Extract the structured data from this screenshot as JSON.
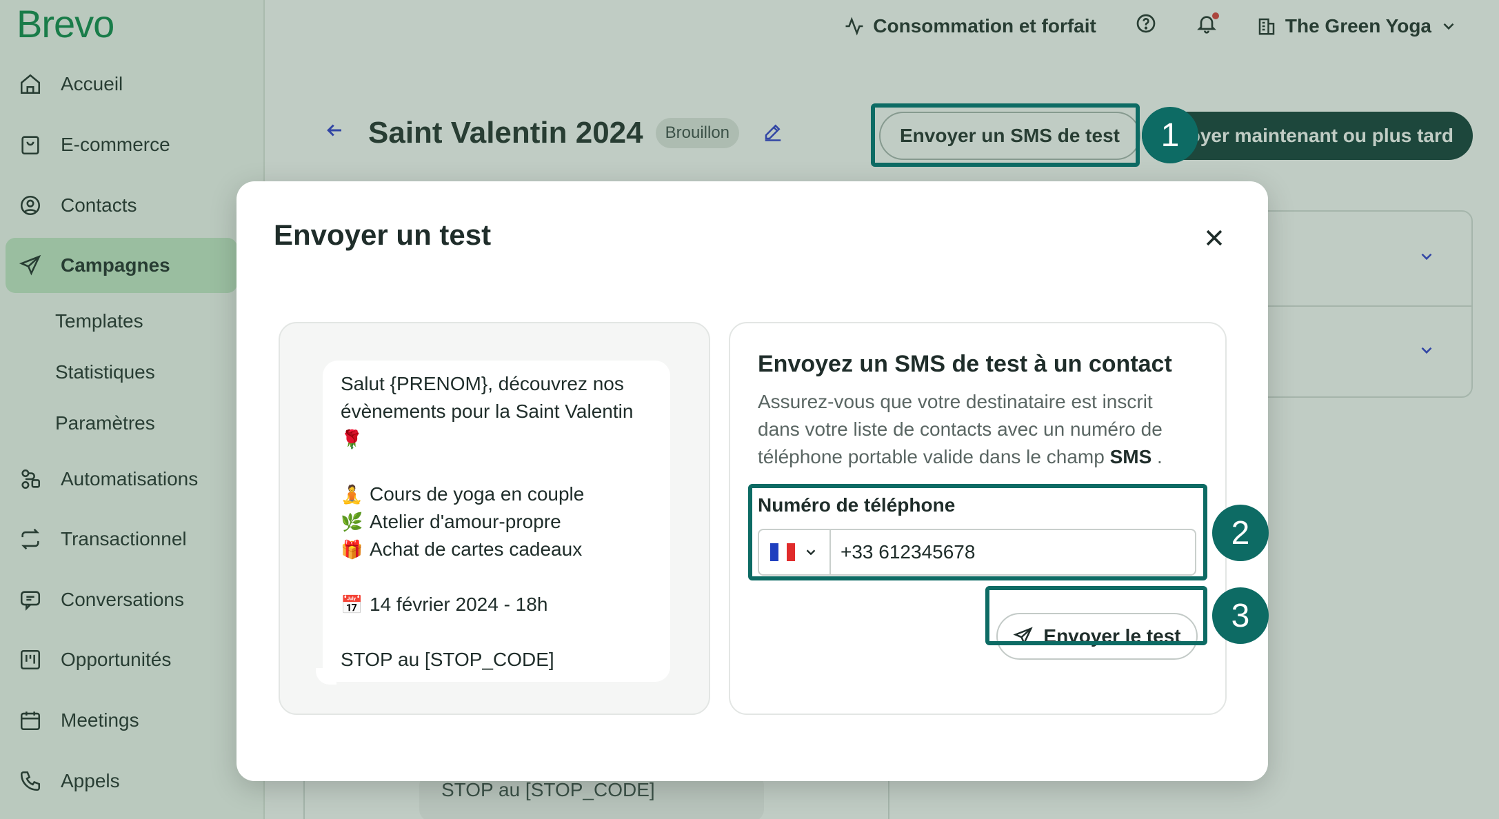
{
  "brand": {
    "logo": "Brevo"
  },
  "sidebar": {
    "items": [
      {
        "label": "Accueil",
        "icon": "home-icon"
      },
      {
        "label": "E-commerce",
        "icon": "shopping-bag-icon"
      },
      {
        "label": "Contacts",
        "icon": "user-circle-icon"
      },
      {
        "label": "Campagnes",
        "icon": "paper-plane-icon",
        "active": true
      },
      {
        "label": "Automatisations",
        "icon": "workflow-icon"
      },
      {
        "label": "Transactionnel",
        "icon": "repeat-icon"
      },
      {
        "label": "Conversations",
        "icon": "chat-icon"
      },
      {
        "label": "Opportunités",
        "icon": "kanban-icon"
      },
      {
        "label": "Meetings",
        "icon": "calendar-icon"
      },
      {
        "label": "Appels",
        "icon": "phone-icon"
      }
    ],
    "subitems": [
      "Templates",
      "Statistiques",
      "Paramètres"
    ]
  },
  "header": {
    "usage_link": "Consommation et forfait",
    "account_name": "The Green Yoga"
  },
  "campaign": {
    "title": "Saint Valentin 2024",
    "status": "Brouillon",
    "send_test_label": "Envoyer un SMS de test",
    "send_label": "Envoyer maintenant ou plus tard"
  },
  "background": {
    "stop_text": "STOP au [STOP_CODE]"
  },
  "modal": {
    "title": "Envoyer un test",
    "preview": {
      "line1": "Salut {PRENOM}, découvrez nos",
      "line2": "évènements pour la Saint Valentin",
      "emoji_rose": "🌹",
      "item1_emoji": "🧘",
      "item1": "Cours de yoga en couple",
      "item2_emoji": "🌿",
      "item2": "Atelier d'amour-propre",
      "item3_emoji": "🎁",
      "item3": "Achat de cartes cadeaux",
      "date_emoji": "📅",
      "date": "14 février 2024 - 18h",
      "stop": "STOP au [STOP_CODE]"
    },
    "form": {
      "title": "Envoyez un SMS de test à un contact",
      "desc_part1": "Assurez-vous que votre destinataire est inscrit dans votre liste de contacts avec un numéro de téléphone portable valide dans le champ",
      "desc_bold": "SMS",
      "desc_end": ".",
      "phone_label": "Numéro de téléphone",
      "phone_value": "+33 612345678",
      "country": "FR",
      "submit_label": "Envoyer le test"
    }
  },
  "steps": [
    "1",
    "2",
    "3"
  ],
  "colors": {
    "brand_green": "#0a8a4a",
    "highlight": "#0d6b64",
    "dark_button": "#0f3b37",
    "accent_blue": "#2f3ad1"
  }
}
